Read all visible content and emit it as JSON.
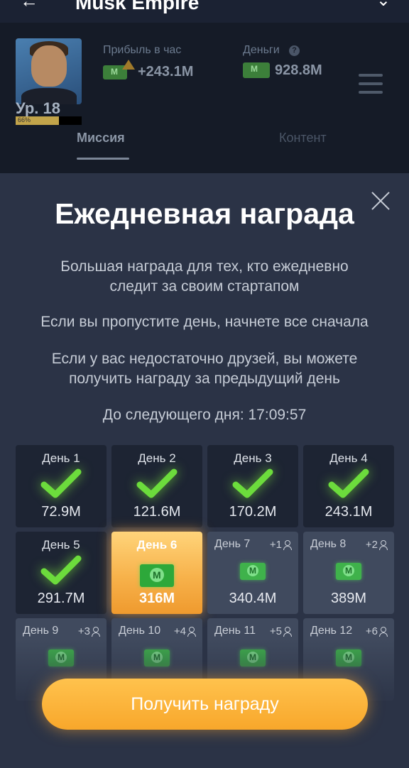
{
  "app_title": "Musk Empire",
  "header": {
    "level_label": "Ур. 18",
    "level_progress_pct": 66,
    "level_progress_text": "66%",
    "profit_label": "Прибыль в час",
    "profit_value": "+243.1M",
    "money_label": "Деньги",
    "money_value": "928.8M"
  },
  "tabs": [
    {
      "label": "Миссия",
      "active": true
    },
    {
      "label": "Контент",
      "active": false
    }
  ],
  "modal": {
    "title": "Ежедневная награда",
    "text1": "Большая награда для тех, кто ежедневно следит за своим стартапом",
    "text2": "Если вы пропустите день, начнете все сначала",
    "text3": "Если у вас недостаточно друзей, вы можете получить награду за предыдущий день",
    "timer": "До следующего дня: 17:09:57",
    "claim_button": "Получить награду"
  },
  "days": [
    {
      "label": "День 1",
      "amount": "72.9M",
      "state": "claimed",
      "friends": ""
    },
    {
      "label": "День 2",
      "amount": "121.6M",
      "state": "claimed",
      "friends": ""
    },
    {
      "label": "День 3",
      "amount": "170.2M",
      "state": "claimed",
      "friends": ""
    },
    {
      "label": "День 4",
      "amount": "243.1M",
      "state": "claimed",
      "friends": ""
    },
    {
      "label": "День 5",
      "amount": "291.7M",
      "state": "claimed",
      "friends": ""
    },
    {
      "label": "День 6",
      "amount": "316M",
      "state": "current",
      "friends": ""
    },
    {
      "label": "День 7",
      "amount": "340.4M",
      "state": "future",
      "friends": "+1"
    },
    {
      "label": "День 8",
      "amount": "389M",
      "state": "future",
      "friends": "+2"
    },
    {
      "label": "День 9",
      "amount": "",
      "state": "future",
      "friends": "+3"
    },
    {
      "label": "День 10",
      "amount": "",
      "state": "future",
      "friends": "+4"
    },
    {
      "label": "День 11",
      "amount": "",
      "state": "future",
      "friends": "+5"
    },
    {
      "label": "День 12",
      "amount": "",
      "state": "future",
      "friends": "+6"
    }
  ],
  "colors": {
    "background": "#2b3346",
    "accent_orange": "#f8a72b",
    "check_green": "#6cdc3c"
  }
}
